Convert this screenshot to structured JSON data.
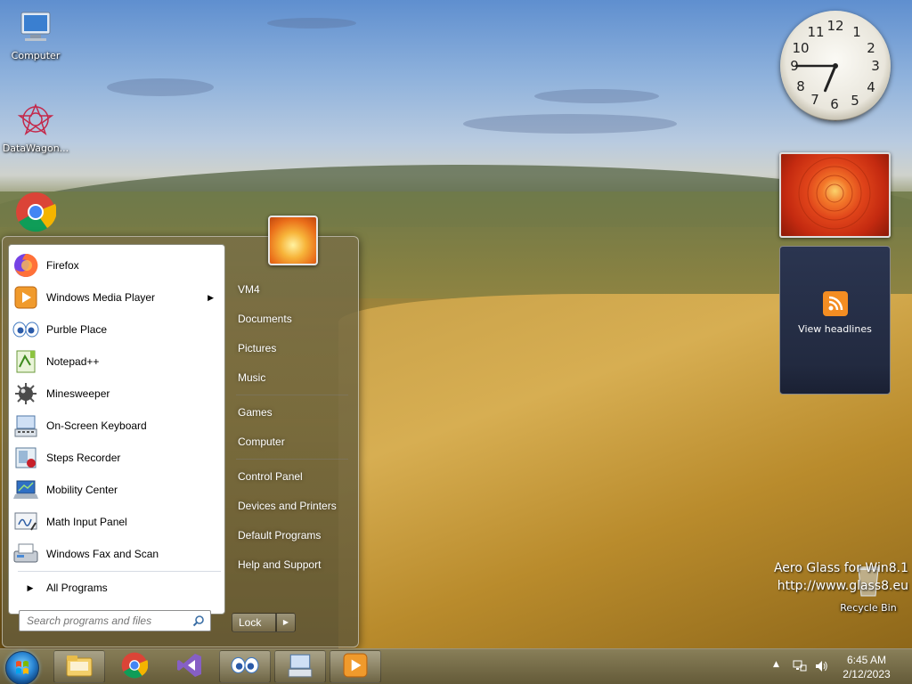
{
  "desktop": {
    "icons": [
      {
        "label": "Computer",
        "icon": "computer-icon"
      },
      {
        "label": "DataWagon...",
        "icon": "datawagon-icon"
      },
      {
        "label": "",
        "icon": "chrome-icon"
      },
      {
        "label": "Recycle Bin",
        "icon": "recycle-bin-icon"
      }
    ],
    "watermark_line1": "Aero Glass for Win8.1",
    "watermark_line2": "http://www.glass8.eu"
  },
  "gadgets": {
    "clock": {
      "numbers": [
        "12",
        "1",
        "2",
        "3",
        "4",
        "5",
        "6",
        "7",
        "8",
        "9",
        "10",
        "11"
      ],
      "hour": 6,
      "minute": 45
    },
    "feed": {
      "label": "View headlines"
    }
  },
  "start_menu": {
    "programs": [
      {
        "label": "Firefox",
        "icon": "firefox-icon",
        "has_submenu": false
      },
      {
        "label": "Windows Media Player",
        "icon": "media-player-icon",
        "has_submenu": true
      },
      {
        "label": "Purble Place",
        "icon": "purble-place-icon",
        "has_submenu": false
      },
      {
        "label": "Notepad++",
        "icon": "notepadpp-icon",
        "has_submenu": false
      },
      {
        "label": "Minesweeper",
        "icon": "minesweeper-icon",
        "has_submenu": false
      },
      {
        "label": "On-Screen Keyboard",
        "icon": "keyboard-icon",
        "has_submenu": false
      },
      {
        "label": "Steps Recorder",
        "icon": "steps-recorder-icon",
        "has_submenu": false
      },
      {
        "label": "Mobility Center",
        "icon": "mobility-center-icon",
        "has_submenu": false
      },
      {
        "label": "Math Input Panel",
        "icon": "math-input-icon",
        "has_submenu": false
      },
      {
        "label": "Windows Fax and Scan",
        "icon": "fax-scan-icon",
        "has_submenu": false
      }
    ],
    "all_programs": "All Programs",
    "search_placeholder": "Search programs and files",
    "right_items": [
      {
        "label": "VM4",
        "group": 1
      },
      {
        "label": "Documents",
        "group": 1
      },
      {
        "label": "Pictures",
        "group": 1
      },
      {
        "label": "Music",
        "group": 1
      },
      {
        "label": "Games",
        "group": 2
      },
      {
        "label": "Computer",
        "group": 2
      },
      {
        "label": "Control Panel",
        "group": 3
      },
      {
        "label": "Devices and Printers",
        "group": 3
      },
      {
        "label": "Default Programs",
        "group": 3
      },
      {
        "label": "Help and Support",
        "group": 3
      }
    ],
    "lock_label": "Lock"
  },
  "taskbar": {
    "pinned": [
      "explorer-icon",
      "chrome-icon",
      "visual-studio-icon",
      "purble-place-icon",
      "keyboard-icon",
      "media-player-icon"
    ],
    "time": "6:45 AM",
    "date": "2/12/2023"
  }
}
